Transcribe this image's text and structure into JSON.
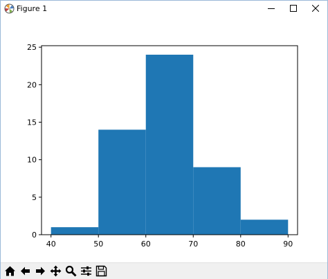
{
  "window": {
    "title": "Figure 1"
  },
  "chart_data": {
    "type": "bar",
    "bins": [
      [
        40,
        50
      ],
      [
        50,
        60
      ],
      [
        60,
        70
      ],
      [
        70,
        80
      ],
      [
        80,
        90
      ]
    ],
    "values": [
      1,
      14,
      24,
      9,
      2
    ],
    "xlim": [
      38,
      92
    ],
    "ylim": [
      0,
      25.2
    ],
    "xticks": [
      40,
      50,
      60,
      70,
      80,
      90
    ],
    "yticks": [
      0,
      5,
      10,
      15,
      20,
      25
    ],
    "bar_color": "#1f77b4",
    "title": "",
    "xlabel": "",
    "ylabel": ""
  },
  "toolbar": {
    "tools": [
      "home-icon",
      "back-arrow-icon",
      "forward-arrow-icon",
      "pan-icon",
      "zoom-icon",
      "configure-subplots-icon",
      "save-icon"
    ]
  }
}
